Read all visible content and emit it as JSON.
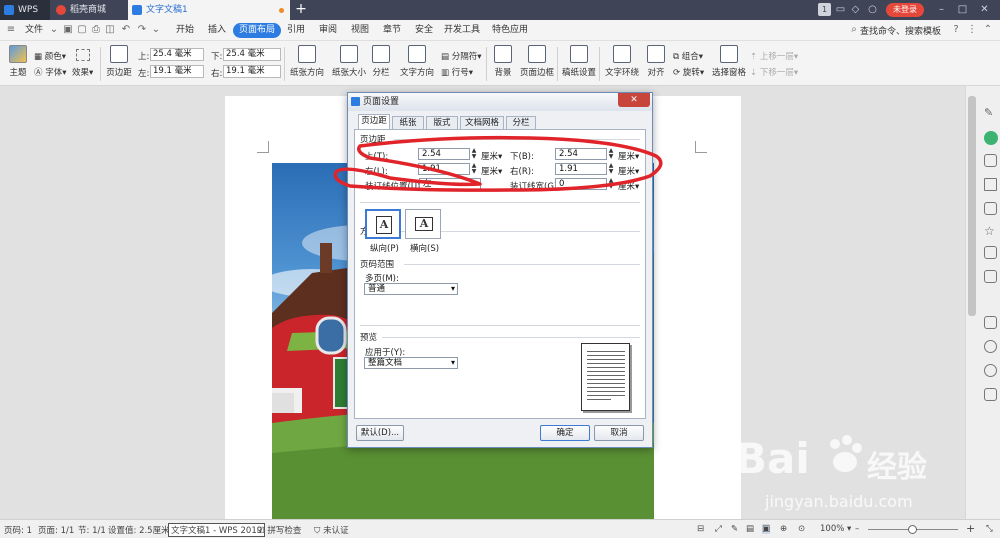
{
  "titlebar": {
    "tabs": [
      {
        "label": "WPS"
      },
      {
        "label": "稻壳商城"
      },
      {
        "label": "文字文稿1"
      }
    ],
    "page_counter": "1",
    "login": "未登录"
  },
  "menubar": {
    "file": "文件",
    "items": [
      "开始",
      "插入",
      "页面布局",
      "引用",
      "审阅",
      "视图",
      "章节",
      "安全",
      "开发工具",
      "特色应用"
    ],
    "active": "页面布局",
    "search": "查找命令、搜索模板"
  },
  "ribbon": {
    "theme": "主题",
    "color": "颜色",
    "font": "字体",
    "effect": "效果",
    "margins": "页边距",
    "top_label": "上:",
    "top_value": "25.4 毫米",
    "bottom_label": "下:",
    "bottom_value": "25.4 毫米",
    "left_label": "左:",
    "left_value": "19.1 毫米",
    "right_label": "右:",
    "right_value": "19.1 毫米",
    "orientation": "纸张方向",
    "size": "纸张大小",
    "columns": "分栏",
    "text_direction": "文字方向",
    "separator": "分隔符",
    "line_number": "行号",
    "background": "背景",
    "page_border": "页面边框",
    "draft_setting": "稿纸设置",
    "text_wrap": "文字环绕",
    "align": "对齐",
    "group": "组合",
    "rotate": "旋转",
    "select_pane": "选择窗格",
    "move_up": "上移一层",
    "move_down": "下移一层"
  },
  "dialog": {
    "title": "页面设置",
    "close": "✕",
    "tabs": [
      "页边距",
      "纸张",
      "版式",
      "文档网格",
      "分栏"
    ],
    "active_tab": "页边距",
    "margins_section": "页边距",
    "top_label": "上(T):",
    "top_value": "2.54",
    "bottom_label": "下(B):",
    "bottom_value": "2.54",
    "left_label": "左(L):",
    "left_value": "1.91",
    "right_label": "右(R):",
    "right_value": "1.91",
    "unit": "厘米▾",
    "gutter_pos_label": "装订线位置(U):",
    "gutter_pos_value": "左",
    "gutter_width_label": "装订线宽(G):",
    "gutter_width_value": "0",
    "orientation_section": "方向",
    "portrait": "纵向(P)",
    "landscape": "横向(S)",
    "orient_glyph": "A",
    "pages_section": "页码范围",
    "multi_pages_label": "多页(M):",
    "multi_pages_value": "普通",
    "preview_section": "预览",
    "apply_label": "应用于(Y):",
    "apply_value": "整篇文档",
    "default_btn": "默认(D)...",
    "ok_btn": "确定",
    "cancel_btn": "取消"
  },
  "statusbar": {
    "page_num": "页码: 1",
    "page": "页面: 1/1",
    "section": "节: 1/1",
    "setting": "设置值: 2.5厘米",
    "tooltip": "文字文稿1 - WPS 2019",
    "spell": "拼写检查",
    "cert": "未认证",
    "zoom": "100%"
  },
  "watermark": {
    "brand": "Bai",
    "brand2": "经验",
    "url": "jingyan.baidu.com"
  },
  "colors": {
    "accent": "#2d7ce1",
    "annotation": "#e0242a",
    "titlebar": "#3f4556"
  }
}
